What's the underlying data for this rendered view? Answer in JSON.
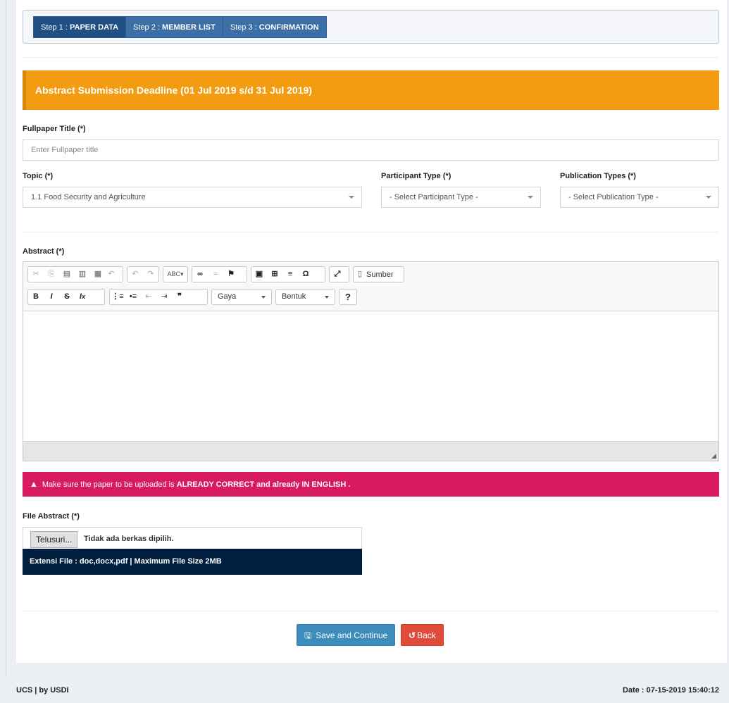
{
  "steps": [
    {
      "prefix": "Step 1 : ",
      "name": "PAPER DATA"
    },
    {
      "prefix": "Step 2 : ",
      "name": "MEMBER LIST"
    },
    {
      "prefix": "Step 3 : ",
      "name": "CONFIRMATION"
    }
  ],
  "deadline": "Abstract Submission Deadline (01 Jul 2019 s/d 31 Jul 2019)",
  "form": {
    "title_label": "Fullpaper Title (*)",
    "title_placeholder": "Enter Fullpaper title",
    "topic_label": "Topic (*)",
    "topic_value": "1.1 Food Security and Agriculture",
    "participant_label": "Participant Type (*)",
    "participant_value": "- Select Participant Type -",
    "publication_label": "Publication Types (*)",
    "publication_value": "- Select Publication Type -",
    "abstract_label": "Abstract (*)"
  },
  "editor": {
    "source_label": "Sumber",
    "style_label": "Gaya",
    "format_label": "Bentuk",
    "help_label": "?"
  },
  "warning": {
    "text": "Make sure the paper to be uploaded is ",
    "bold1": "ALREADY CORRECT",
    "mid": " and ",
    "bold2": "already IN ENGLISH ."
  },
  "file": {
    "label": "File Abstract (*)",
    "browse_label": "Telusuri...",
    "no_file": "Tidak ada berkas dipilih.",
    "extension_note": "Extensi File : doc,docx,pdf  | Maximum File Size 2MB"
  },
  "buttons": {
    "save": "Save and Continue",
    "back": "Back"
  },
  "footer": {
    "left": "UCS | by USDI",
    "right": "Date : 07-15-2019 15:40:12"
  },
  "colors": {
    "deadline": "#f39c12",
    "warning": "#d81b60",
    "save": "#3c8dbc",
    "back": "#dd4b39",
    "step_active": "#1f4f83"
  }
}
